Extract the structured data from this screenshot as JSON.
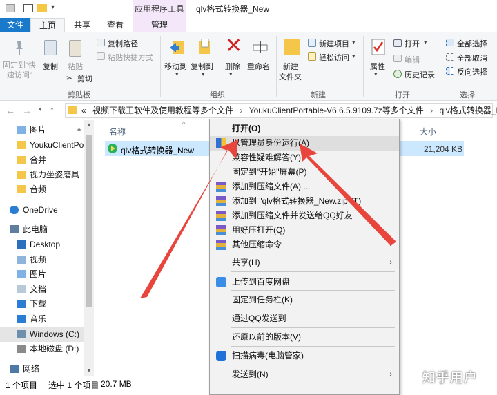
{
  "window": {
    "contextual_tab_label": "应用程序工具",
    "title": "qlv格式转换器_New"
  },
  "ribbon_tabs": [
    "文件",
    "主页",
    "共享",
    "查看",
    "管理"
  ],
  "ribbon": {
    "clipboard": {
      "pin": "固定到\"快",
      "pin2": "速访问\"",
      "copy": "复制",
      "paste": "粘贴",
      "copy_path": "复制路径",
      "paste_shortcut": "粘贴快捷方式",
      "cut": "剪切",
      "group": "剪贴板"
    },
    "organize": {
      "move_to": "移动到",
      "copy_to": "复制到",
      "delete": "删除",
      "rename": "重命名",
      "group": "组织"
    },
    "new": {
      "new_folder": "新建",
      "new_folder2": "文件夹",
      "new_item": "新建项目",
      "easy_access": "轻松访问",
      "group": "新建"
    },
    "open": {
      "properties": "属性",
      "open": "打开",
      "edit": "编辑",
      "history": "历史记录",
      "group": "打开"
    },
    "select": {
      "select_all": "全部选择",
      "select_none": "全部取消",
      "invert": "反向选择",
      "group": "选择"
    }
  },
  "address": {
    "prefix": "«",
    "crumb1": "视频下载王软件及使用教程等多个文件",
    "crumb2": "YoukuClientPortable-V6.6.5.9109.7z等多个文件",
    "crumb3": "qlv格式转换器_New"
  },
  "nav": {
    "items": [
      {
        "label": "图片"
      },
      {
        "label": "YoukuClientPor"
      },
      {
        "label": "合并"
      },
      {
        "label": "视力坐姿磨具"
      },
      {
        "label": "音频"
      },
      {
        "label": "OneDrive"
      },
      {
        "label": "此电脑"
      },
      {
        "label": "Desktop"
      },
      {
        "label": "视频"
      },
      {
        "label": "图片"
      },
      {
        "label": "文档"
      },
      {
        "label": "下载"
      },
      {
        "label": "音乐"
      },
      {
        "label": "Windows (C:)"
      },
      {
        "label": "本地磁盘 (D:)"
      },
      {
        "label": "网络"
      }
    ]
  },
  "content": {
    "col_name": "名称",
    "col_size": "大小",
    "file_name": "qlv格式转换器_New",
    "file_size": "21,204 KB"
  },
  "status": {
    "items": "1 个项目",
    "selected": "选中 1 个项目",
    "size": "20.7 MB"
  },
  "context_menu": {
    "items": [
      "打开(O)",
      "以管理员身份运行(A)",
      "兼容性疑难解答(Y)",
      "固定到\"开始\"屏幕(P)",
      "添加到压缩文件(A) ...",
      "添加到 \"qlv格式转换器_New.zip\"(T)",
      "添加到压缩文件并发送给QQ好友",
      "用好压打开(Q)",
      "其他压缩命令",
      "共享(H)",
      "上传到百度网盘",
      "固定到任务栏(K)",
      "通过QQ发送到",
      "还原以前的版本(V)",
      "扫描病毒(电脑管家)",
      "发送到(N)"
    ]
  },
  "watermark": "知乎用户",
  "colors": {
    "accent": "#1979ca",
    "arrow": "#e8453c",
    "selection": "#cce8ff",
    "manage_tab": "#f3e7f9"
  }
}
